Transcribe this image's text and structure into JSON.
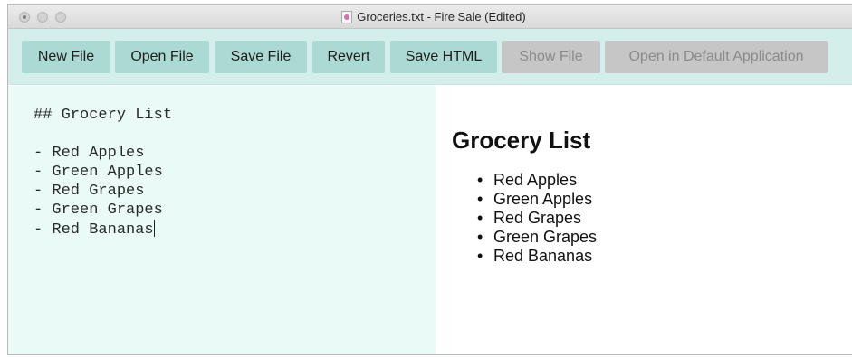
{
  "window": {
    "title": "Groceries.txt - Fire Sale (Edited)",
    "icon": "text-document-icon"
  },
  "toolbar": {
    "buttons": [
      {
        "label": "New File",
        "enabled": true
      },
      {
        "label": "Open File",
        "enabled": true
      },
      {
        "label": "Save File",
        "enabled": true
      },
      {
        "label": "Revert",
        "enabled": true
      },
      {
        "label": "Save HTML",
        "enabled": true
      },
      {
        "label": "Show File",
        "enabled": false
      },
      {
        "label": "Open in Default Application",
        "enabled": false
      }
    ]
  },
  "editor": {
    "heading_line": "## Grocery List",
    "lines": [
      "- Red Apples",
      "- Green Apples",
      "- Red Grapes",
      "- Green Grapes",
      "- Red Bananas"
    ]
  },
  "preview": {
    "heading": "Grocery List",
    "items": [
      "Red Apples",
      "Green Apples",
      "Red Grapes",
      "Green Grapes",
      "Red Bananas"
    ]
  },
  "colors": {
    "toolbar_bg": "#d4efeb",
    "button_bg": "#aadad3",
    "button_disabled_bg": "#c6c6c6",
    "editor_bg": "#eafaf6",
    "preview_bg": "#ffffff"
  }
}
